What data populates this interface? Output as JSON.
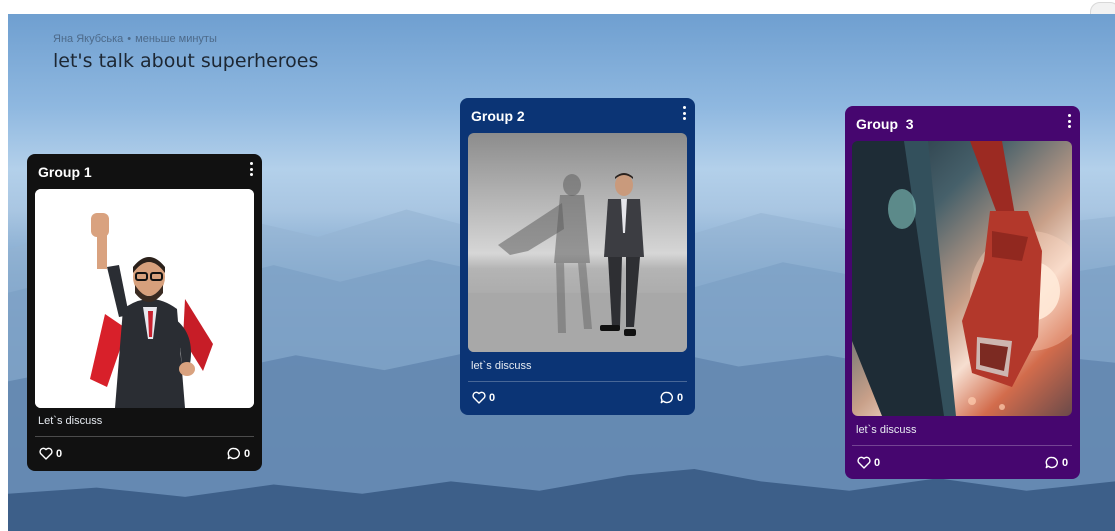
{
  "header": {
    "author": "Яна Якубська",
    "separator": "•",
    "time_ago": "меньше минуты",
    "title": "let's talk about superheroes"
  },
  "cards": [
    {
      "title": "Group 1",
      "caption": "Let`s discuss",
      "likes": "0",
      "comments": "0",
      "image": "businessman-in-red-cape-raising-fist"
    },
    {
      "title": "Group 2",
      "caption": "let`s discuss",
      "likes": "0",
      "comments": "0",
      "image": "businessman-with-superhero-cape-shadow"
    },
    {
      "title": "Group  3",
      "caption": "let`s discuss",
      "likes": "0",
      "comments": "0",
      "image": "superhero-hand-with-glove-in-sunlight"
    }
  ],
  "colors": {
    "card1_bg": "#111111",
    "card2_bg": "#0b3475",
    "card3_bg": "#46066f",
    "sky_top": "#6f9fd0",
    "mountains": "#4a6f9a"
  },
  "icons": {
    "menu": "more-vertical-icon",
    "like": "heart-icon",
    "comment": "comment-icon"
  }
}
